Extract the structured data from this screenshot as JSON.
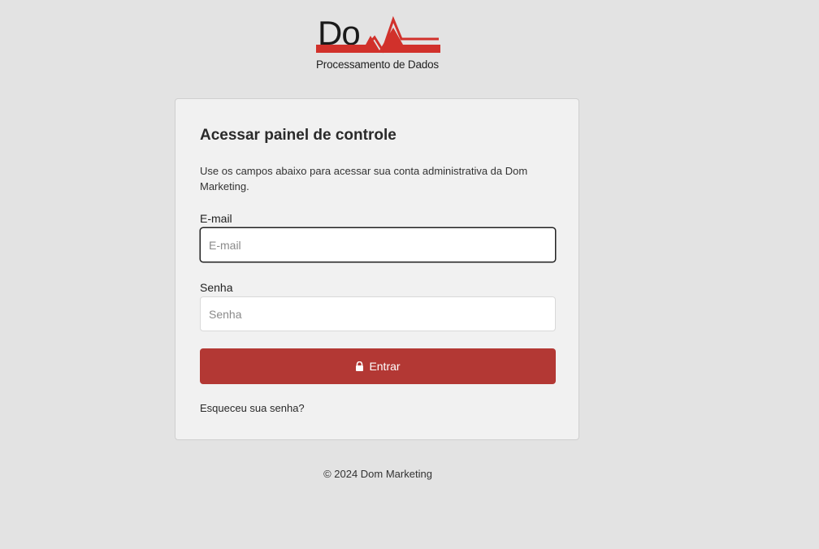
{
  "logo": {
    "word": "Do",
    "subtitle": "Processamento de Dados",
    "accent_color": "#d1312b"
  },
  "login": {
    "title": "Acessar painel de controle",
    "description": "Use os campos abaixo para acessar sua conta administrativa da Dom Marketing.",
    "email_label": "E-mail",
    "email_placeholder": "E-mail",
    "email_value": "",
    "password_label": "Senha",
    "password_placeholder": "Senha",
    "password_value": "",
    "submit_label": "Entrar",
    "submit_icon": "lock-icon",
    "forgot_link": "Esqueceu sua senha?"
  },
  "footer": {
    "copyright": "© 2024 Dom Marketing"
  },
  "colors": {
    "background": "#e3e3e3",
    "card": "#f1f1f1",
    "primary_button": "#b33834"
  }
}
